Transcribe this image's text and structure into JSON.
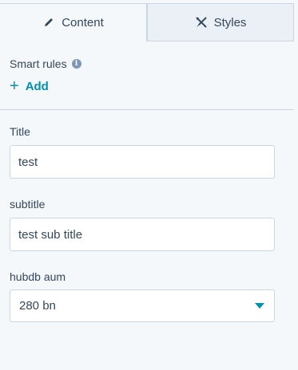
{
  "tabs": [
    {
      "label": "Content",
      "icon": "pencil-icon",
      "active": true
    },
    {
      "label": "Styles",
      "icon": "paint-tools-icon",
      "active": false
    }
  ],
  "smart_rules": {
    "label": "Smart rules",
    "info_icon": "i",
    "add_label": "Add",
    "add_icon": "+"
  },
  "fields": {
    "title": {
      "label": "Title",
      "value": "test"
    },
    "subtitle": {
      "label": "subtitle",
      "value": "test sub title"
    },
    "hubdb": {
      "label": "hubdb aum",
      "value": "280 bn"
    }
  },
  "colors": {
    "accent": "#0091ae",
    "text": "#33475b",
    "border": "#cbd6e2",
    "background": "#f5f8fa"
  }
}
